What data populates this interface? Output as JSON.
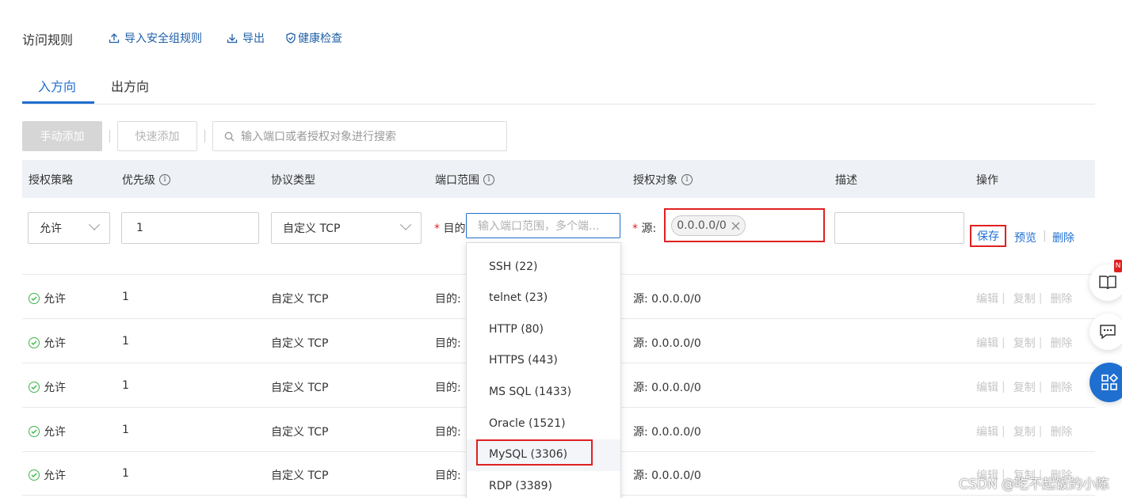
{
  "header": {
    "title": "访问规则",
    "links": [
      {
        "label": "导入安全组规则",
        "icon": "upload-icon"
      },
      {
        "label": "导出",
        "icon": "download-icon"
      },
      {
        "label": "健康检查",
        "icon": "shield-check-icon"
      }
    ]
  },
  "tabs": [
    {
      "label": "入方向",
      "active": true
    },
    {
      "label": "出方向",
      "active": false
    }
  ],
  "toolbar": {
    "manual_add": "手动添加",
    "quick_add": "快速添加",
    "search_placeholder": "输入端口或者授权对象进行搜索"
  },
  "table": {
    "columns": [
      "授权策略",
      "优先级",
      "协议类型",
      "端口范围",
      "授权对象",
      "描述",
      "操作"
    ],
    "edit_row": {
      "policy": "允许",
      "priority": "1",
      "protocol": "自定义 TCP",
      "dest_label": "目的",
      "port_placeholder": "输入端口范围，多个端...",
      "source_label": "源:",
      "source_chip": "0.0.0.0/0",
      "description": "",
      "actions": [
        "保存",
        "预览",
        "删除"
      ]
    },
    "rows": [
      {
        "policy": "允许",
        "priority": "1",
        "protocol": "自定义 TCP",
        "dest": "目的: ",
        "source": "源: 0.0.0.0/0"
      },
      {
        "policy": "允许",
        "priority": "1",
        "protocol": "自定义 TCP",
        "dest": "目的: ",
        "source": "源: 0.0.0.0/0"
      },
      {
        "policy": "允许",
        "priority": "1",
        "protocol": "自定义 TCP",
        "dest": "目的: ",
        "source": "源: 0.0.0.0/0"
      },
      {
        "policy": "允许",
        "priority": "1",
        "protocol": "自定义 TCP",
        "dest": "目的: ",
        "source": "源: 0.0.0.0/0"
      },
      {
        "policy": "允许",
        "priority": "1",
        "protocol": "自定义 TCP",
        "dest": "目的: ",
        "source": "源: 0.0.0.0/0"
      }
    ],
    "row_actions": [
      "编辑",
      "复制",
      "删除"
    ]
  },
  "port_dropdown": [
    "SSH (22)",
    "telnet (23)",
    "HTTP (80)",
    "HTTPS (443)",
    "MS SQL (1433)",
    "Oracle (1521)",
    "MySQL (3306)",
    "RDP (3389)"
  ],
  "side_buttons": [
    {
      "icon": "book-icon",
      "badge": "N"
    },
    {
      "icon": "chat-icon"
    },
    {
      "icon": "apps-icon"
    }
  ],
  "watermark": "CSDN @吃不起饭的小陈",
  "colors": {
    "accent": "#1f6fd1",
    "highlight": "#e02020",
    "success": "#3cb44b"
  }
}
